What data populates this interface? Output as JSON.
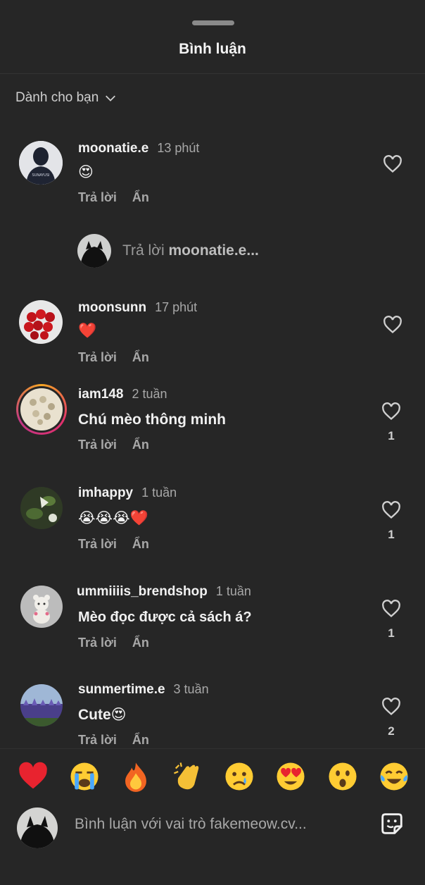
{
  "header": {
    "title": "Bình luận"
  },
  "filter": {
    "label": "Dành cho bạn"
  },
  "actions": {
    "reply": "Trả lời",
    "hide": "Ẩn"
  },
  "comments": [
    {
      "username": "moonatie.e",
      "time": "13 phút",
      "text": "😍",
      "likes": ""
    },
    {
      "username": "moonsunn",
      "time": "17 phút",
      "text": "❤️",
      "likes": ""
    },
    {
      "username": "iam148",
      "time": "2 tuần",
      "text": "Chú mèo thông minh",
      "likes": "1"
    },
    {
      "username": "imhappy",
      "time": "1 tuần",
      "text": "😭😭😭❤️",
      "likes": "1"
    },
    {
      "username": "ummiiiis_brendshop",
      "time": "1 tuần",
      "text": "Mèo đọc được cả sách á?",
      "likes": "1"
    },
    {
      "username": "sunmertime.e",
      "time": "3 tuần",
      "text": "Cute😍",
      "likes": "2"
    }
  ],
  "reply_prompt": {
    "prefix": "Trả lời ",
    "username": "moonatie.e..."
  },
  "emoji_bar": [
    "heart",
    "loudly-crying",
    "fire",
    "clapping-hands",
    "crying",
    "heart-eyes",
    "surprised",
    "tears-of-joy"
  ],
  "composer": {
    "placeholder": "Bình luận với vai trò fakemeow.cv..."
  }
}
